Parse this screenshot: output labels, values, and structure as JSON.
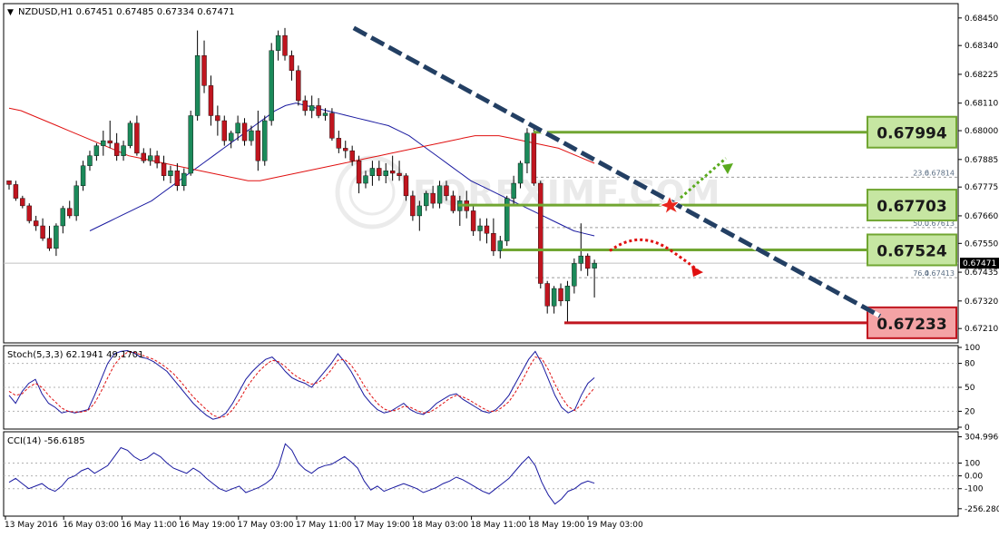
{
  "chart_data": [
    {
      "type": "candlestick",
      "title": "NZDUSD,H1  0.67451 0.67485 0.67334 0.67471",
      "symbol": "NZDUSD",
      "timeframe": "H1",
      "ohlc_header": {
        "open": 0.67451,
        "high": 0.67485,
        "low": 0.67334,
        "close": 0.67471
      },
      "ylim": [
        0.6716,
        0.685
      ],
      "y_ticks": [
        0.6845,
        0.6834,
        0.68225,
        0.6811,
        0.68,
        0.67885,
        0.67775,
        0.6766,
        0.6755,
        0.67435,
        0.6732,
        0.6721
      ],
      "y_tick_labels": [
        "0.68450",
        "0.68340",
        "0.68225",
        "0.68110",
        "0.68000",
        "0.67885",
        "0.67775",
        "0.67660",
        "0.67550",
        "0.67435",
        "0.67320",
        "0.67210"
      ],
      "x_labels": [
        "13 May 2016",
        "16 May 03:00",
        "16 May 11:00",
        "16 May 19:00",
        "17 May 03:00",
        "17 May 11:00",
        "17 May 19:00",
        "18 May 03:00",
        "18 May 11:00",
        "18 May 19:00",
        "19 May 03:00"
      ],
      "current_price_label": "0.67471",
      "fibonacci": [
        {
          "label": "23.6",
          "price_label": "0.67814",
          "value": 0.67814
        },
        {
          "label": "38.2",
          "price_label": "0.67703",
          "value": 0.67703
        },
        {
          "label": "50.0",
          "price_label": "0.67613",
          "value": 0.67613
        },
        {
          "label": "76.4",
          "price_label": "0.67413",
          "value": 0.67413
        }
      ],
      "levels": [
        {
          "label": "0.67994",
          "value": 0.67994,
          "color": "#71a632",
          "box_fill": "#c6e6a2"
        },
        {
          "label": "0.67703",
          "value": 0.67703,
          "color": "#71a632",
          "box_fill": "#c6e6a2"
        },
        {
          "label": "0.67524",
          "value": 0.67524,
          "color": "#71a632",
          "box_fill": "#c6e6a2"
        },
        {
          "label": "0.67233",
          "value": 0.67233,
          "color": "#c0151f",
          "box_fill": "#f4a3a5"
        }
      ],
      "trendline": {
        "color": "#233f63",
        "from": [
          2,
          0.6841
        ],
        "to": [
          60,
          0.6726
        ]
      },
      "watermark": "FOREXIMF.COM",
      "candles": [
        [
          0.678,
          0.678,
          0.67765,
          0.67785
        ],
        [
          0.67785,
          0.678,
          0.6772,
          0.6773
        ],
        [
          0.6773,
          0.6774,
          0.6769,
          0.677
        ],
        [
          0.677,
          0.6771,
          0.6763,
          0.6764
        ],
        [
          0.6764,
          0.6766,
          0.676,
          0.6762
        ],
        [
          0.6762,
          0.6765,
          0.6756,
          0.6757
        ],
        [
          0.6757,
          0.6762,
          0.6752,
          0.6753
        ],
        [
          0.6753,
          0.6763,
          0.675,
          0.6762
        ],
        [
          0.6762,
          0.677,
          0.6759,
          0.6769
        ],
        [
          0.6769,
          0.6772,
          0.6765,
          0.6766
        ],
        [
          0.6766,
          0.678,
          0.6764,
          0.6778
        ],
        [
          0.6778,
          0.6788,
          0.6776,
          0.6786
        ],
        [
          0.6786,
          0.6792,
          0.6784,
          0.679
        ],
        [
          0.679,
          0.6795,
          0.6788,
          0.6794
        ],
        [
          0.6794,
          0.68,
          0.679,
          0.6796
        ],
        [
          0.6796,
          0.6804,
          0.6793,
          0.6795
        ],
        [
          0.6795,
          0.6799,
          0.6788,
          0.679
        ],
        [
          0.679,
          0.6796,
          0.6788,
          0.6794
        ],
        [
          0.6794,
          0.6804,
          0.6793,
          0.6803
        ],
        [
          0.6803,
          0.6806,
          0.679,
          0.6791
        ],
        [
          0.6791,
          0.6793,
          0.6787,
          0.6788
        ],
        [
          0.6788,
          0.6793,
          0.6786,
          0.679
        ],
        [
          0.679,
          0.6792,
          0.6785,
          0.6787
        ],
        [
          0.6787,
          0.679,
          0.678,
          0.6782
        ],
        [
          0.6782,
          0.6786,
          0.6779,
          0.6784
        ],
        [
          0.6784,
          0.6787,
          0.6776,
          0.6778
        ],
        [
          0.6778,
          0.6785,
          0.6776,
          0.6783
        ],
        [
          0.6783,
          0.6808,
          0.6782,
          0.6806
        ],
        [
          0.6806,
          0.684,
          0.6804,
          0.683
        ],
        [
          0.683,
          0.6836,
          0.6815,
          0.6818
        ],
        [
          0.6818,
          0.6822,
          0.6802,
          0.6806
        ],
        [
          0.6806,
          0.681,
          0.6798,
          0.6804
        ],
        [
          0.6804,
          0.6806,
          0.6794,
          0.6796
        ],
        [
          0.6796,
          0.68,
          0.6793,
          0.6799
        ],
        [
          0.6799,
          0.6806,
          0.6796,
          0.6803
        ],
        [
          0.6803,
          0.6805,
          0.6794,
          0.6796
        ],
        [
          0.6796,
          0.6802,
          0.6794,
          0.68
        ],
        [
          0.68,
          0.6808,
          0.6784,
          0.6788
        ],
        [
          0.6788,
          0.6806,
          0.6786,
          0.6804
        ],
        [
          0.6804,
          0.6835,
          0.6802,
          0.6832
        ],
        [
          0.6832,
          0.684,
          0.6828,
          0.6838
        ],
        [
          0.6838,
          0.6841,
          0.6828,
          0.683
        ],
        [
          0.683,
          0.6832,
          0.682,
          0.6824
        ],
        [
          0.6824,
          0.6826,
          0.681,
          0.6812
        ],
        [
          0.6812,
          0.6814,
          0.6806,
          0.6808
        ],
        [
          0.6808,
          0.6814,
          0.6805,
          0.681
        ],
        [
          0.681,
          0.6813,
          0.6805,
          0.6806
        ],
        [
          0.6806,
          0.6809,
          0.6804,
          0.6807
        ],
        [
          0.6807,
          0.6809,
          0.6796,
          0.6797
        ],
        [
          0.6797,
          0.68,
          0.6791,
          0.6793
        ],
        [
          0.6793,
          0.6796,
          0.6789,
          0.6792
        ],
        [
          0.6792,
          0.6794,
          0.6786,
          0.6788
        ],
        [
          0.6788,
          0.679,
          0.6775,
          0.6779
        ],
        [
          0.6779,
          0.6784,
          0.6777,
          0.6782
        ],
        [
          0.6782,
          0.6788,
          0.6778,
          0.6785
        ],
        [
          0.6785,
          0.6788,
          0.678,
          0.6782
        ],
        [
          0.6782,
          0.6787,
          0.6779,
          0.6784
        ],
        [
          0.6784,
          0.679,
          0.678,
          0.6783
        ],
        [
          0.6783,
          0.6788,
          0.678,
          0.6782
        ],
        [
          0.6782,
          0.6783,
          0.6772,
          0.6774
        ],
        [
          0.6774,
          0.6776,
          0.6764,
          0.6766
        ],
        [
          0.6766,
          0.6772,
          0.676,
          0.677
        ],
        [
          0.677,
          0.6776,
          0.6768,
          0.6775
        ],
        [
          0.6775,
          0.6778,
          0.6769,
          0.6771
        ],
        [
          0.6771,
          0.678,
          0.6769,
          0.6778
        ],
        [
          0.6778,
          0.678,
          0.6772,
          0.6774
        ],
        [
          0.6774,
          0.6776,
          0.6767,
          0.6768
        ],
        [
          0.6768,
          0.6774,
          0.6762,
          0.6772
        ],
        [
          0.6772,
          0.6776,
          0.6765,
          0.6768
        ],
        [
          0.6768,
          0.677,
          0.6758,
          0.676
        ],
        [
          0.676,
          0.6765,
          0.6756,
          0.6762
        ],
        [
          0.6762,
          0.6765,
          0.6755,
          0.6759
        ],
        [
          0.6759,
          0.6765,
          0.675,
          0.6752
        ],
        [
          0.6752,
          0.6758,
          0.6749,
          0.6756
        ],
        [
          0.6756,
          0.6774,
          0.6754,
          0.6773
        ],
        [
          0.6773,
          0.6782,
          0.677,
          0.6779
        ],
        [
          0.6779,
          0.6788,
          0.6777,
          0.6787
        ],
        [
          0.6787,
          0.6801,
          0.6783,
          0.6799
        ],
        [
          0.6799,
          0.6801,
          0.6778,
          0.6779
        ],
        [
          0.6779,
          0.678,
          0.6737,
          0.6739
        ],
        [
          0.6739,
          0.674,
          0.6727,
          0.673
        ],
        [
          0.673,
          0.6738,
          0.6727,
          0.6737
        ],
        [
          0.6737,
          0.6739,
          0.673,
          0.6732
        ],
        [
          0.6732,
          0.674,
          0.6723,
          0.6738
        ],
        [
          0.6738,
          0.6749,
          0.6735,
          0.6747
        ],
        [
          0.6747,
          0.6763,
          0.6744,
          0.675
        ],
        [
          0.675,
          0.6751,
          0.6742,
          0.6745
        ],
        [
          0.67451,
          0.67485,
          0.67334,
          0.67471
        ]
      ],
      "ma_blue": [
        0.676,
        0.6762,
        0.6764,
        0.6766,
        0.6768,
        0.677,
        0.6772,
        0.6775,
        0.6778,
        0.6781,
        0.6784,
        0.6787,
        0.679,
        0.6793,
        0.6796,
        0.6799,
        0.6802,
        0.6805,
        0.6808,
        0.681,
        0.6811,
        0.681,
        0.6809,
        0.6808,
        0.6807,
        0.6806,
        0.6805,
        0.6804,
        0.6803,
        0.6802,
        0.68,
        0.6798,
        0.6795,
        0.6792,
        0.6789,
        0.6786,
        0.6783,
        0.678,
        0.6778,
        0.6776,
        0.6774,
        0.6772,
        0.677,
        0.6768,
        0.6766,
        0.6764,
        0.6762,
        0.676,
        0.6759,
        0.6758
      ],
      "ma_blue_start": 12,
      "ma_red": [
        0.6809,
        0.6808,
        0.6806,
        0.6804,
        0.6802,
        0.68,
        0.6798,
        0.6796,
        0.6794,
        0.6792,
        0.679,
        0.6789,
        0.6788,
        0.6787,
        0.6786,
        0.6785,
        0.6784,
        0.6783,
        0.6782,
        0.6781,
        0.678,
        0.678,
        0.6781,
        0.6782,
        0.6783,
        0.6784,
        0.6785,
        0.6786,
        0.6787,
        0.6788,
        0.6789,
        0.679,
        0.6791,
        0.6792,
        0.6793,
        0.6794,
        0.6795,
        0.6796,
        0.6797,
        0.6798,
        0.6798,
        0.6798,
        0.6797,
        0.6796,
        0.6795,
        0.6794,
        0.6793,
        0.6791,
        0.6789,
        0.6787
      ],
      "ma_red_start": 0
    },
    {
      "type": "line",
      "title": "Stoch(5,3,3) 62.1941 49.1701",
      "ylim": [
        0,
        100
      ],
      "y_ticks": [
        0,
        20,
        50,
        80,
        100
      ],
      "y_tick_labels": [
        "0",
        "20",
        "50",
        "80",
        "100"
      ],
      "series": [
        {
          "values": [
            40,
            30,
            45,
            55,
            60,
            42,
            30,
            25,
            18,
            20,
            18,
            20,
            22,
            40,
            60,
            80,
            92,
            95,
            96,
            93,
            88,
            86,
            82,
            76,
            70,
            60,
            50,
            40,
            30,
            22,
            15,
            10,
            12,
            18,
            30,
            45,
            60,
            70,
            78,
            85,
            88,
            80,
            70,
            62,
            58,
            55,
            50,
            60,
            70,
            80,
            92,
            82,
            70,
            55,
            40,
            30,
            22,
            18,
            20,
            25,
            30,
            22,
            18,
            16,
            22,
            30,
            35,
            40,
            42,
            35,
            30,
            25,
            20,
            18,
            22,
            30,
            40,
            55,
            70,
            85,
            95,
            80,
            60,
            40,
            25,
            18,
            22,
            40,
            55,
            62
          ],
          "color": "#1a1aa0"
        },
        {
          "values": [
            45,
            40,
            42,
            50,
            55,
            50,
            40,
            32,
            24,
            20,
            19,
            19,
            21,
            30,
            45,
            62,
            78,
            88,
            94,
            94,
            91,
            88,
            85,
            80,
            74,
            67,
            58,
            48,
            38,
            30,
            22,
            15,
            12,
            14,
            22,
            34,
            48,
            60,
            70,
            78,
            84,
            82,
            76,
            68,
            62,
            58,
            54,
            56,
            62,
            72,
            84,
            85,
            78,
            66,
            52,
            40,
            30,
            23,
            20,
            22,
            26,
            25,
            21,
            18,
            19,
            24,
            30,
            36,
            40,
            38,
            34,
            29,
            24,
            20,
            20,
            25,
            32,
            44,
            58,
            74,
            88,
            86,
            72,
            54,
            38,
            26,
            21,
            28,
            40,
            49
          ],
          "color": "#e01010"
        }
      ]
    },
    {
      "type": "line",
      "title": "CCI(14) -56.6185",
      "ylim": [
        -300,
        330
      ],
      "y_ticks": [
        304.9966,
        100,
        0,
        -100,
        -256.2805
      ],
      "y_tick_labels": [
        "304.9966",
        "100",
        "0.00",
        "-100",
        "-256.2805"
      ],
      "series": [
        {
          "values": [
            -50,
            -20,
            -60,
            -100,
            -80,
            -60,
            -100,
            -120,
            -80,
            -20,
            0,
            40,
            60,
            20,
            50,
            80,
            150,
            220,
            200,
            150,
            120,
            140,
            180,
            150,
            100,
            60,
            40,
            20,
            60,
            30,
            -20,
            -60,
            -100,
            -120,
            -100,
            -80,
            -130,
            -110,
            -90,
            -60,
            -20,
            80,
            250,
            200,
            100,
            50,
            20,
            60,
            80,
            90,
            120,
            150,
            110,
            60,
            -40,
            -110,
            -80,
            -120,
            -100,
            -80,
            -60,
            -80,
            -100,
            -130,
            -110,
            -90,
            -60,
            -40,
            -10,
            -30,
            -60,
            -90,
            -120,
            -140,
            -100,
            -60,
            -20,
            40,
            100,
            150,
            80,
            -50,
            -150,
            -220,
            -180,
            -120,
            -100,
            -60,
            -40,
            -57
          ],
          "color": "#1a1aa0"
        }
      ]
    }
  ]
}
